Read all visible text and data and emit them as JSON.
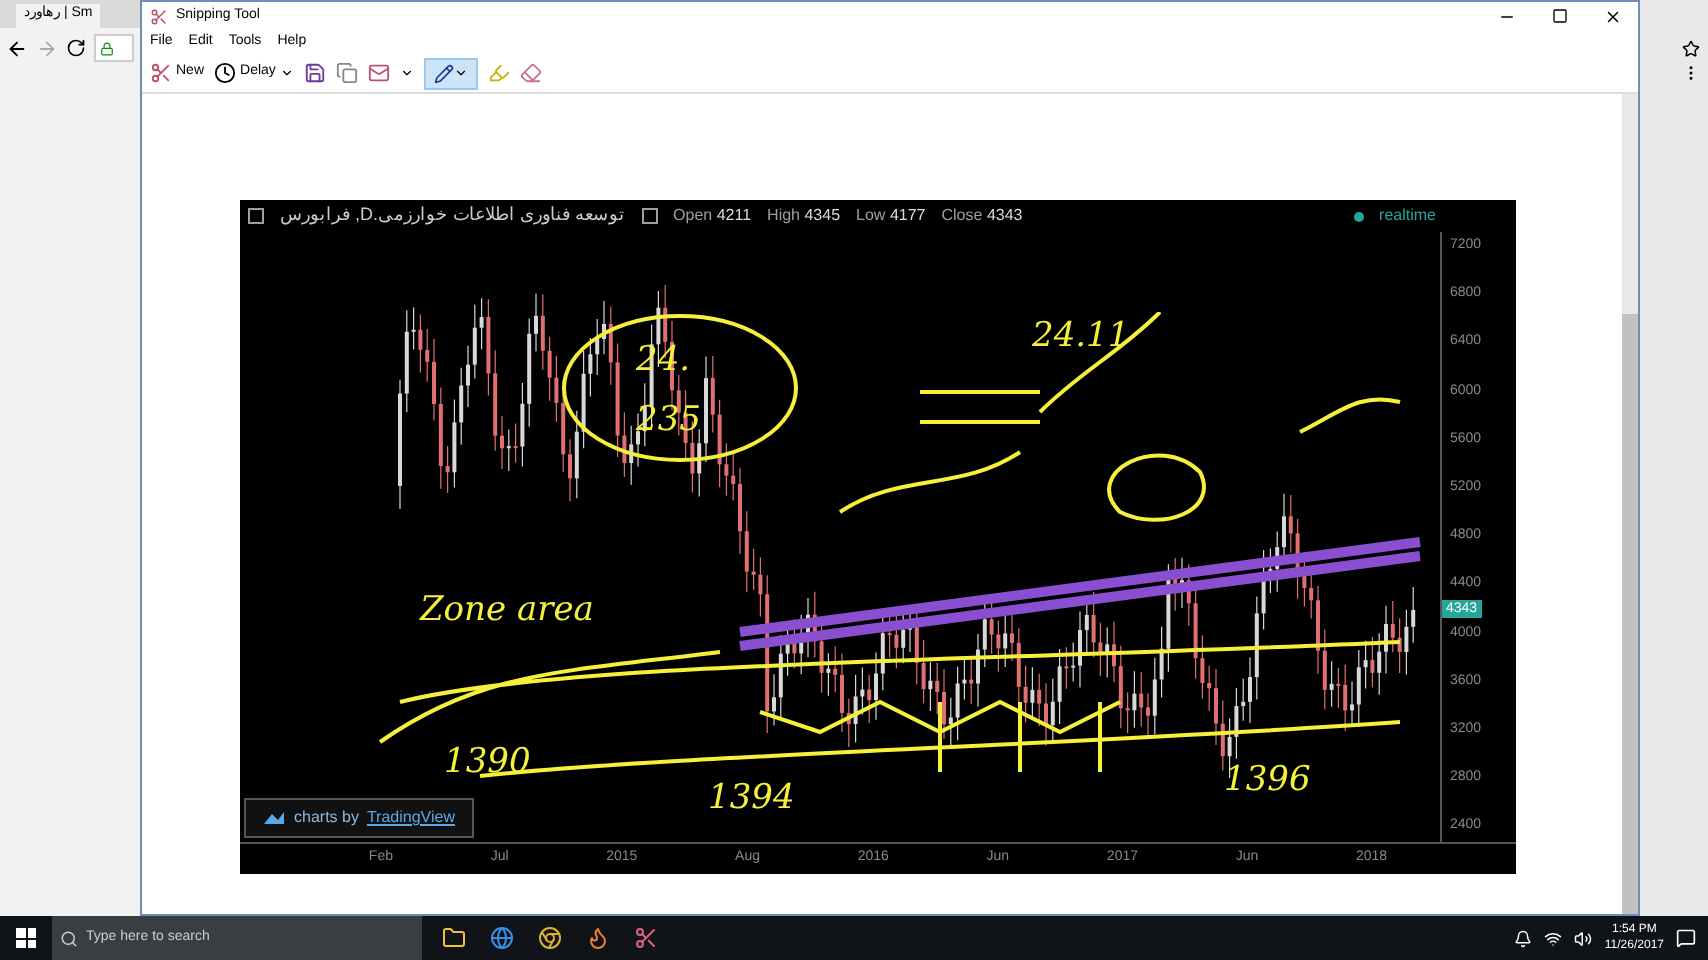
{
  "browser": {
    "tab_title": "رهاورد | Sm"
  },
  "window": {
    "title": "Snipping Tool"
  },
  "menu": [
    "File",
    "Edit",
    "Tools",
    "Help"
  ],
  "toolbar": {
    "new_label": "New",
    "delay_label": "Delay",
    "pen_selected": true
  },
  "chart": {
    "symbol": "فرابورس ,D.توسعه فناوری اطلاعات خوارزمی",
    "ohlc": [
      {
        "label": "Open",
        "value": "4211"
      },
      {
        "label": "High",
        "value": "4345"
      },
      {
        "label": "Low",
        "value": "4177"
      },
      {
        "label": "Close",
        "value": "4343"
      }
    ],
    "status": "realtime",
    "price_label": "4343",
    "yticks": [
      "7200",
      "6800",
      "6400",
      "6000",
      "5600",
      "5200",
      "4800",
      "4400",
      "4000",
      "3600",
      "3200",
      "2800",
      "2400"
    ],
    "xticks": [
      "Feb",
      "Jul",
      "2015",
      "Aug",
      "2016",
      "Jun",
      "2017",
      "Jun",
      "2018"
    ],
    "credit_prefix": "charts by",
    "credit_brand": "TradingView"
  },
  "annotations": [
    {
      "text": "24."
    },
    {
      "text": "235"
    },
    {
      "text": "24.11"
    },
    {
      "text": "Zone area"
    },
    {
      "text": "1390"
    },
    {
      "text": "1394"
    },
    {
      "text": "1396"
    }
  ],
  "taskbar": {
    "search_placeholder": "Type here to search",
    "time": "1:54 PM",
    "date": "11/26/2017"
  }
}
